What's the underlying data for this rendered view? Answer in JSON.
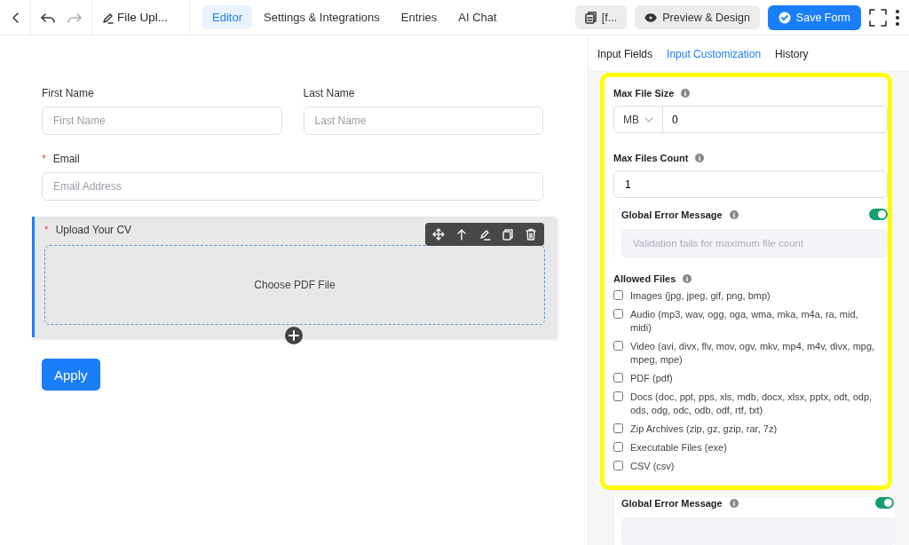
{
  "topbar": {
    "title": "File Upl...",
    "tabs": [
      {
        "label": "Editor",
        "selected": true
      },
      {
        "label": "Settings & Integrations",
        "selected": false
      },
      {
        "label": "Entries",
        "selected": false
      },
      {
        "label": "AI Chat",
        "selected": false
      }
    ],
    "shortcode": "[f...",
    "preview": "Preview & Design",
    "save": "Save Form"
  },
  "form": {
    "rows": [
      {
        "fields": [
          {
            "label": "First Name",
            "placeholder": "First Name"
          },
          {
            "label": "Last Name",
            "placeholder": "Last Name"
          }
        ]
      },
      {
        "fields": [
          {
            "label": "Email",
            "placeholder": "Email Address",
            "required_mark": "*"
          }
        ]
      }
    ],
    "upload": {
      "label": "Upload Your CV",
      "required_mark": "*",
      "button_text": "Choose PDF File"
    },
    "submit": "Apply"
  },
  "panel": {
    "tabs": [
      {
        "label": "Input Fields",
        "selected": false
      },
      {
        "label": "Input Customization",
        "selected": true
      },
      {
        "label": "History",
        "selected": false
      }
    ],
    "max_file_size": {
      "label": "Max File Size",
      "unit": "MB",
      "value": "0"
    },
    "max_files_count": {
      "label": "Max Files Count",
      "value": "1"
    },
    "count_error": {
      "label": "Global Error Message",
      "on": true,
      "placeholder": "Validation fails for maximum file count"
    },
    "allowed_files": {
      "label": "Allowed Files",
      "options": [
        {
          "label": "Images (jpg, jpeg, gif, png, bmp)",
          "checked": false
        },
        {
          "label": "Audio (mp3, wav, ogg, oga, wma, mka, m4a, ra, mid, midi)",
          "checked": false
        },
        {
          "label": "Video (avi, divx, flv, mov, ogv, mkv, mp4, m4v, divx, mpg, mpeg, mpe)",
          "checked": false
        },
        {
          "label": "PDF (pdf)",
          "checked": false
        },
        {
          "label": "Docs (doc, ppt, pps, xls, mdb, docx, xlsx, pptx, odt, odp, ods, odg, odc, odb, odf, rtf, txt)",
          "checked": false
        },
        {
          "label": "Zip Archives (zip, gz, gzip, rar, 7z)",
          "checked": false
        },
        {
          "label": "Executable Files (exe)",
          "checked": false
        },
        {
          "label": "CSV (csv)",
          "checked": false
        }
      ]
    },
    "type_error": {
      "label": "Global Error Message",
      "on": true
    }
  }
}
